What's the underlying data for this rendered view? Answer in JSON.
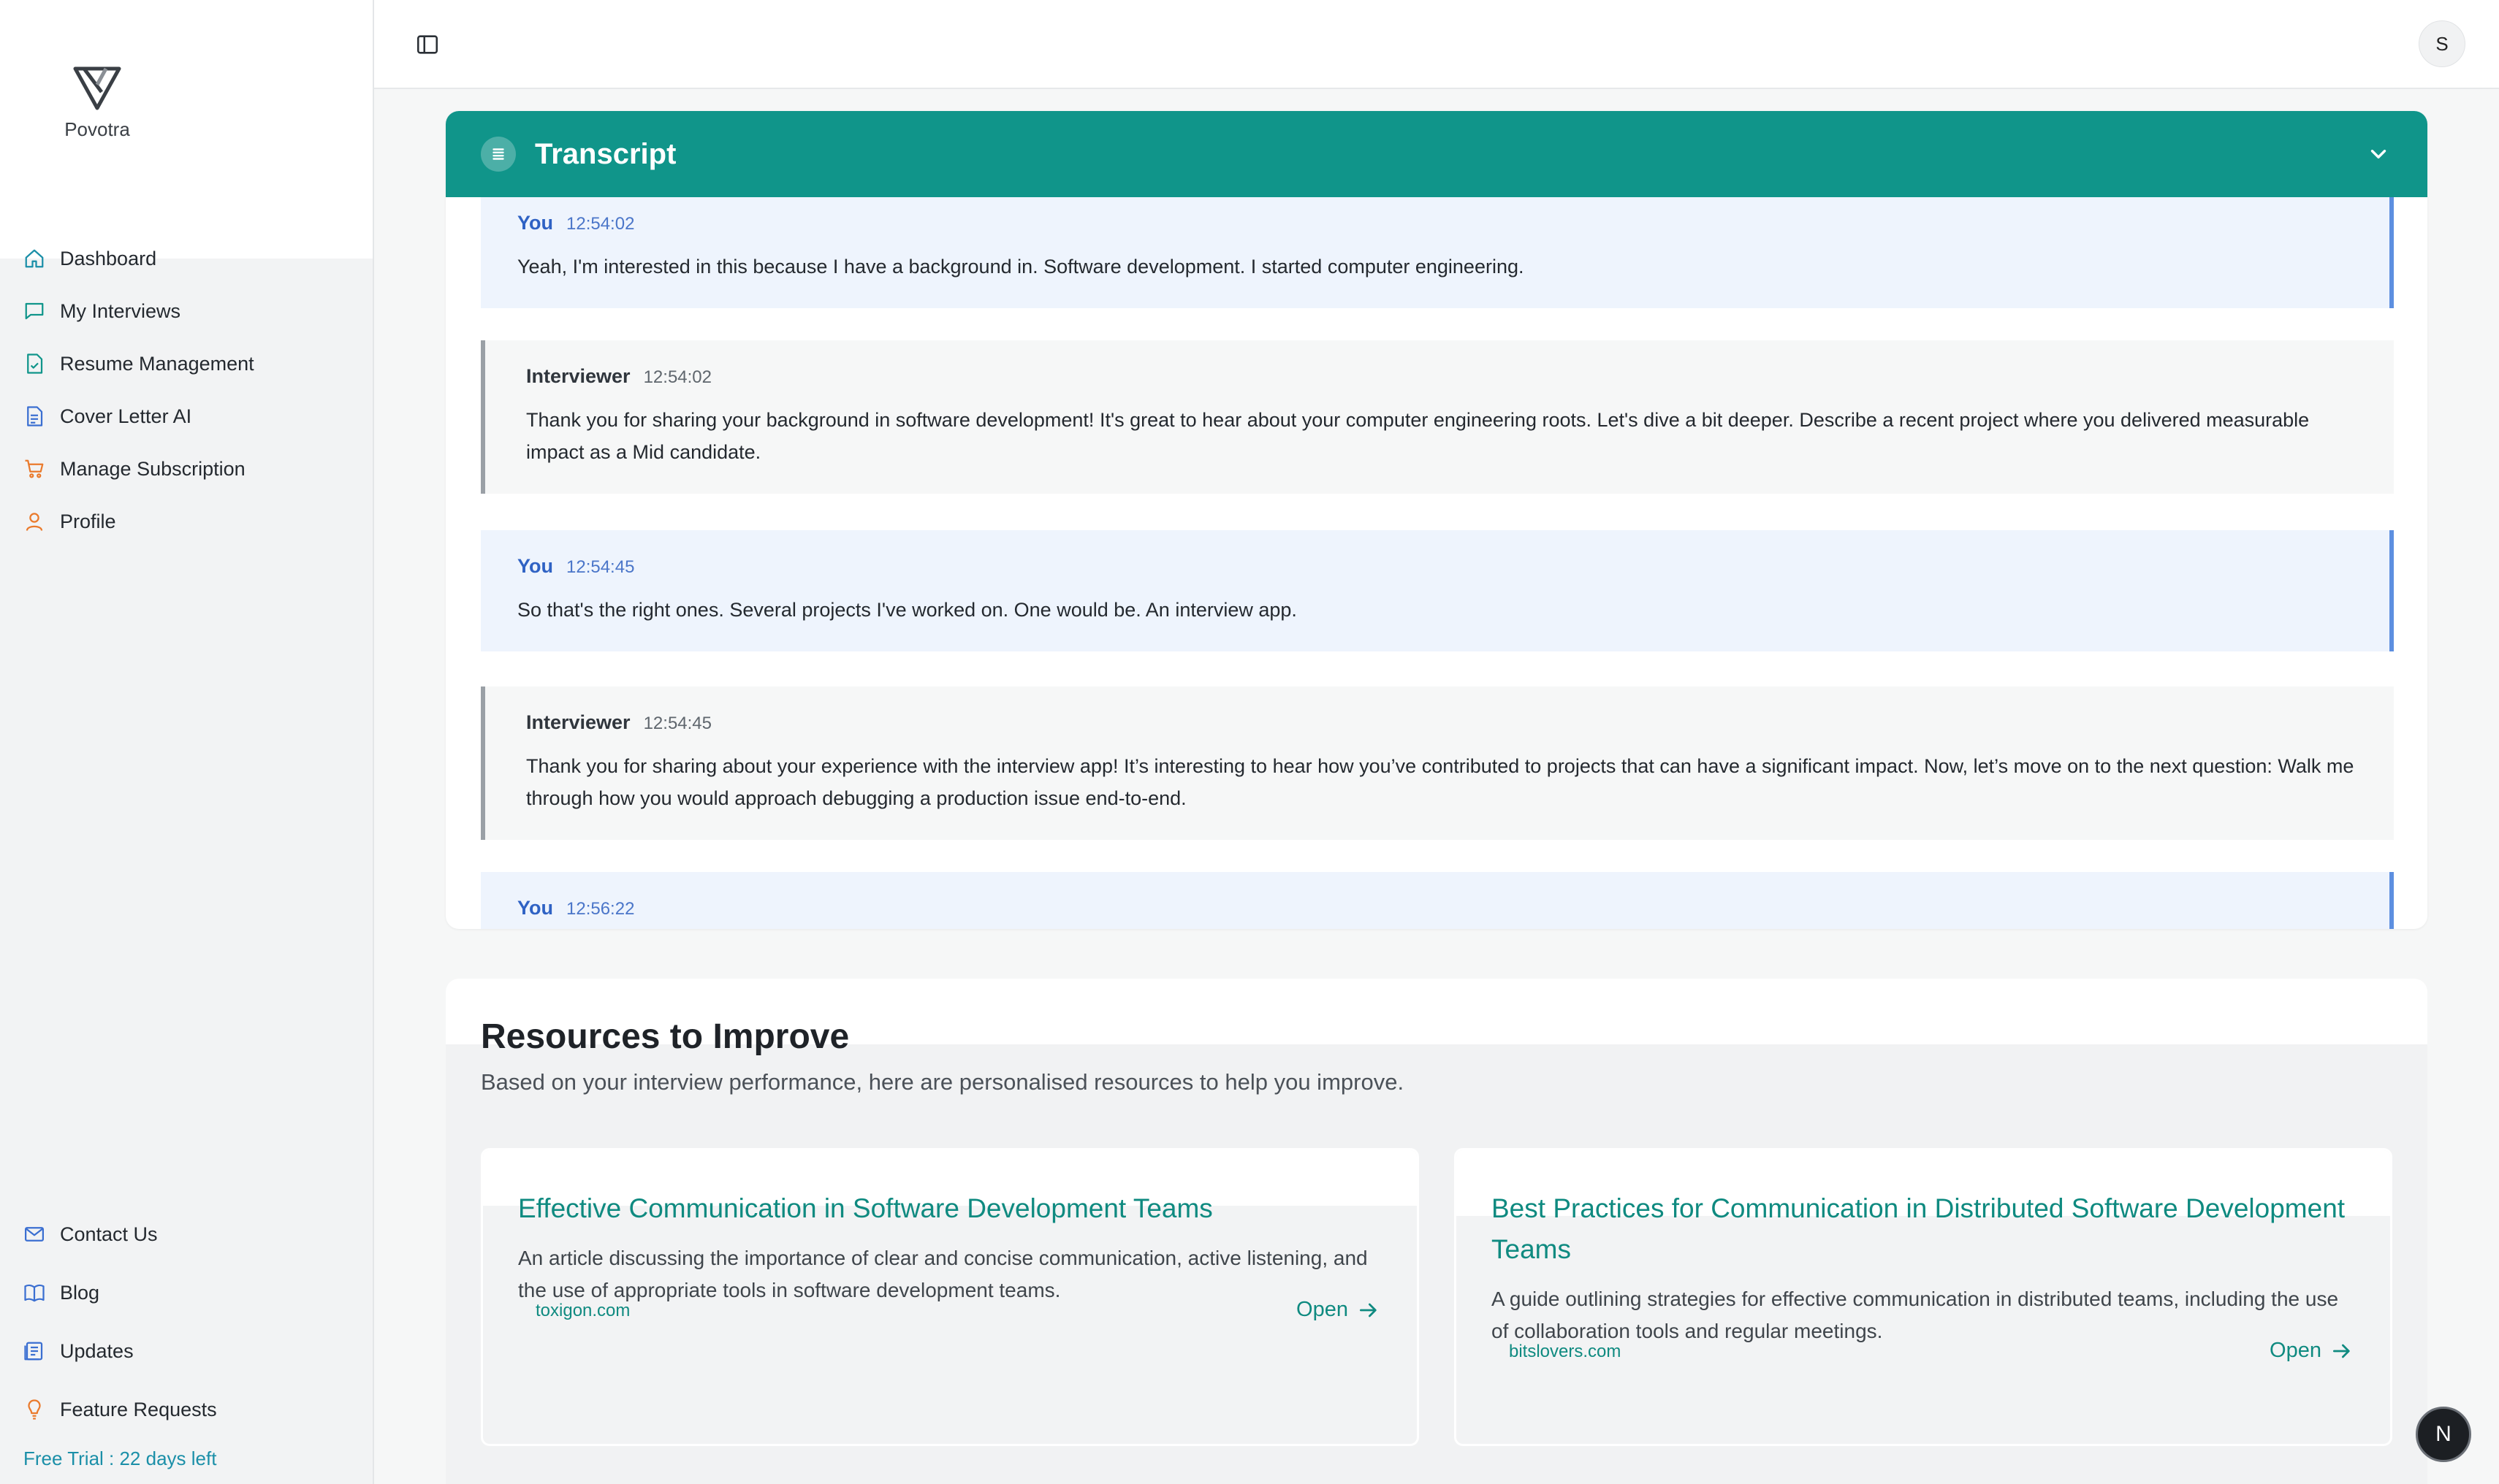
{
  "sidebar": {
    "logo_text": "Povotra",
    "nav": [
      {
        "label": "Dashboard",
        "icon": "home-icon",
        "color": "#1b8fa8"
      },
      {
        "label": "My Interviews",
        "icon": "chat-icon",
        "color": "#10958a"
      },
      {
        "label": "Resume Management",
        "icon": "file-check-icon",
        "color": "#10958a"
      },
      {
        "label": "Cover Letter AI",
        "icon": "document-icon",
        "color": "#3b6fd1"
      },
      {
        "label": "Manage Subscription",
        "icon": "cart-icon",
        "color": "#ea7a2c"
      },
      {
        "label": "Profile",
        "icon": "user-icon",
        "color": "#ea7a2c"
      }
    ],
    "bottom_nav": [
      {
        "label": "Contact Us",
        "icon": "mail-icon"
      },
      {
        "label": "Blog",
        "icon": "book-icon"
      },
      {
        "label": "Updates",
        "icon": "news-icon"
      },
      {
        "label": "Feature Requests",
        "icon": "lightbulb-icon"
      }
    ],
    "trial_text": "Free Trial : 22 days left"
  },
  "topbar": {
    "avatar_initial": "S"
  },
  "transcript": {
    "title": "Transcript",
    "messages": [
      {
        "speaker": "You",
        "time": "12:54:02",
        "text": "Yeah, I'm interested in this because I have a background in. Software development. I started computer engineering."
      },
      {
        "speaker": "Interviewer",
        "time": "12:54:02",
        "text": "Thank you for sharing your background in software development! It's great to hear about your computer engineering roots. Let's dive a bit deeper. Describe a recent project where you delivered measurable impact as a Mid candidate."
      },
      {
        "speaker": "You",
        "time": "12:54:45",
        "text": "So that's the right ones. Several projects I've worked on. One would be. An interview app."
      },
      {
        "speaker": "Interviewer",
        "time": "12:54:45",
        "text": "Thank you for sharing about your experience with the interview app! It’s interesting to hear how you’ve contributed to projects that can have a significant impact. Now, let’s move on to the next question: Walk me through how you would approach debugging a production issue end-to-end."
      },
      {
        "speaker": "You",
        "time": "12:56:22",
        "text": ""
      }
    ]
  },
  "resources": {
    "title": "Resources to Improve",
    "subtitle": "Based on your interview performance, here are personalised resources to help you improve.",
    "cards": [
      {
        "title": "Effective Communication in Software Development Teams",
        "description": "An article discussing the importance of clear and concise communication, active listening, and the use of appropriate tools in software development teams.",
        "domain": "toxigon.com",
        "open_label": "Open"
      },
      {
        "title": "Best Practices for Communication in Distributed Software Development Teams",
        "description": "A guide outlining strategies for effective communication in distributed teams, including the use of collaboration tools and regular meetings.",
        "domain": "bitslovers.com",
        "open_label": "Open"
      }
    ]
  },
  "fab": {
    "label": "N"
  },
  "colors": {
    "accent": "#10958a",
    "you_bubble": "#eef4fd",
    "you_border": "#5d8fe0",
    "interviewer_bubble": "#f6f7f7"
  }
}
